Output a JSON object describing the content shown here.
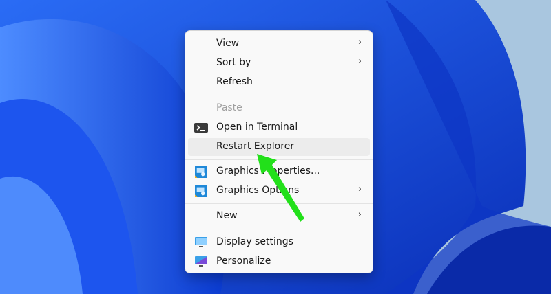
{
  "menu": {
    "items": [
      {
        "label": "View",
        "chevron": "›"
      },
      {
        "label": "Sort by",
        "chevron": "›"
      },
      {
        "label": "Refresh"
      },
      {
        "label": "Paste",
        "disabled": true
      },
      {
        "label": "Open in Terminal",
        "icon": "terminal-icon"
      },
      {
        "label": "Restart Explorer",
        "highlighted": true
      },
      {
        "label": "Graphics Properties...",
        "icon": "intel-graphics-icon"
      },
      {
        "label": "Graphics Options",
        "icon": "intel-graphics-icon",
        "chevron": "›"
      },
      {
        "label": "New",
        "chevron": "›"
      },
      {
        "label": "Display settings",
        "icon": "display-icon"
      },
      {
        "label": "Personalize",
        "icon": "personalize-icon"
      }
    ]
  },
  "colors": {
    "annotation_arrow": "#22e01a",
    "wallpaper": "#1a4fe0"
  }
}
